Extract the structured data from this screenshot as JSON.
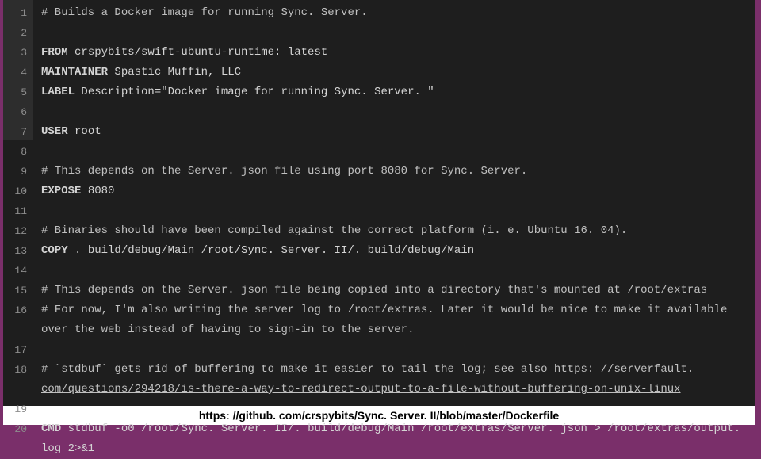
{
  "caption": "https: //github. com/crspybits/Sync. Server. II/blob/master/Dockerfile",
  "lines": [
    {
      "n": 1,
      "type": "comment",
      "text": "# Builds a Docker image for running Sync. Server."
    },
    {
      "n": 2,
      "type": "blank",
      "text": ""
    },
    {
      "n": 3,
      "type": "code",
      "kw": "FROM",
      "rest": " crspybits/swift-ubuntu-runtime: latest"
    },
    {
      "n": 4,
      "type": "code",
      "kw": "MAINTAINER",
      "rest": " Spastic Muffin, LLC"
    },
    {
      "n": 5,
      "type": "code",
      "kw": "LABEL",
      "rest": " Description=\"Docker image for running Sync. Server. \""
    },
    {
      "n": 6,
      "type": "blank",
      "text": ""
    },
    {
      "n": 7,
      "type": "code",
      "kw": "USER",
      "rest": " root"
    },
    {
      "n": 8,
      "type": "blank",
      "text": ""
    },
    {
      "n": 9,
      "type": "comment",
      "text": "# This depends on the Server. json file using port 8080 for Sync. Server."
    },
    {
      "n": 10,
      "type": "code",
      "kw": "EXPOSE",
      "rest": " 8080"
    },
    {
      "n": 11,
      "type": "blank",
      "text": ""
    },
    {
      "n": 12,
      "type": "comment",
      "text": "# Binaries should have been compiled against the correct platform (i. e. Ubuntu 16. 04)."
    },
    {
      "n": 13,
      "type": "code",
      "kw": "COPY",
      "rest": " . build/debug/Main /root/Sync. Server. II/. build/debug/Main"
    },
    {
      "n": 14,
      "type": "blank",
      "text": ""
    },
    {
      "n": 15,
      "type": "comment",
      "text": "# This depends on the Server. json file being copied into a directory that's mounted at /root/extras"
    },
    {
      "n": 16,
      "type": "commentwrap",
      "text": "# For now, I'm also writing the server log to /root/extras. Later it would be nice to make it available over the web instead of having to sign-in to the server."
    },
    {
      "n": 17,
      "type": "blank",
      "text": ""
    },
    {
      "n": 18,
      "type": "commentlink",
      "pre": "# `stdbuf` gets rid of buffering to make it easier to tail the log; see also ",
      "link": "https: //serverfault. com/questions/294218/is-there-a-way-to-redirect-output-to-a-file-without-buffering-on-unix-linux"
    },
    {
      "n": 19,
      "type": "blank",
      "text": ""
    },
    {
      "n": 20,
      "type": "codewrap",
      "kw": "CMD",
      "rest": " stdbuf -o0 /root/Sync. Server. II/. build/debug/Main /root/extras/Server. json > /root/extras/output. log 2>&1"
    }
  ]
}
